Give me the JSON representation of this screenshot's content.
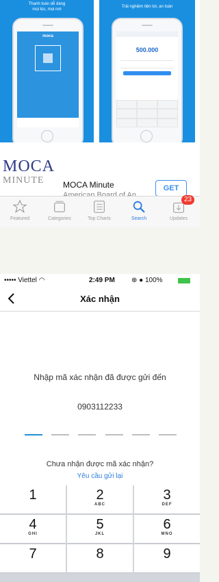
{
  "appstore": {
    "screenshot1": {
      "caption_line1": "Thanh toán dễ dàng",
      "caption_line2": "mọi lúc, mọi nơi",
      "phone_app_name": "moca"
    },
    "screenshot2": {
      "caption": "Trải nghiệm tiện lợi, an toàn",
      "amount": "500.000"
    },
    "app": {
      "logo_line1": "MOCA",
      "logo_line2": "MINUTE",
      "title": "MOCA Minute",
      "subtitle": "American Board of An...",
      "get_label": "GET"
    },
    "tabs": [
      {
        "label": "Featured",
        "icon": "star-icon"
      },
      {
        "label": "Categories",
        "icon": "categories-icon"
      },
      {
        "label": "Top Charts",
        "icon": "list-icon"
      },
      {
        "label": "Search",
        "icon": "search-icon",
        "active": true
      },
      {
        "label": "Updates",
        "icon": "download-icon",
        "badge": "23"
      }
    ]
  },
  "verify": {
    "status": {
      "carrier": "••••• Viettel",
      "time": "2:49 PM",
      "battery": "100%"
    },
    "nav": {
      "title": "Xác nhận"
    },
    "prompt": "Nhập mã xác nhận đã được gửi đến",
    "phone_number": "0903112233",
    "code_length": 6,
    "active_dash": 1,
    "not_received": "Chưa nhận được mã xác nhận?",
    "resend": "Yêu cầu gửi lại",
    "keypad": [
      {
        "num": "1",
        "sub": ""
      },
      {
        "num": "2",
        "sub": "ABC"
      },
      {
        "num": "3",
        "sub": "DEF"
      },
      {
        "num": "4",
        "sub": "GHI"
      },
      {
        "num": "5",
        "sub": "JKL"
      },
      {
        "num": "6",
        "sub": "MNO"
      },
      {
        "num": "7",
        "sub": ""
      },
      {
        "num": "8",
        "sub": ""
      },
      {
        "num": "9",
        "sub": ""
      }
    ]
  },
  "colors": {
    "accent": "#2b7de0",
    "appstore_blue": "#1a8fe0",
    "badge_red": "#f03a2e",
    "battery_green": "#3fc34a",
    "page_bg": "#f4f5ef"
  }
}
